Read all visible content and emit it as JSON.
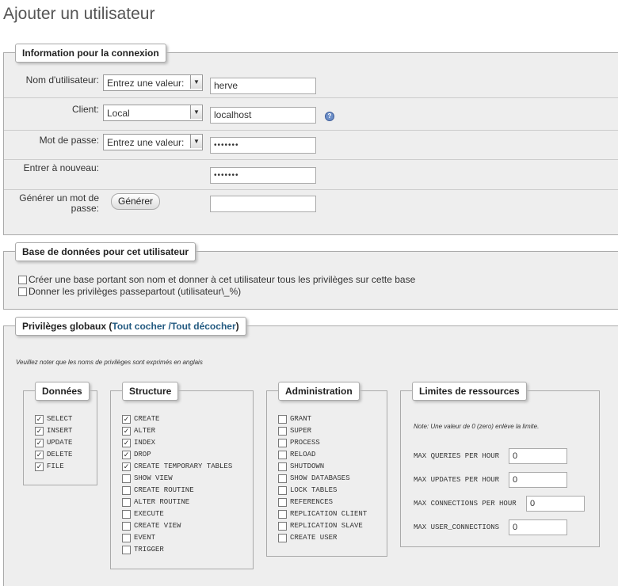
{
  "page_title": "Ajouter un utilisateur",
  "connexion": {
    "legend": "Information pour la connexion",
    "username_label": "Nom d'utilisateur:",
    "username_select": "Entrez une valeur:",
    "username_value": "herve",
    "client_label": "Client:",
    "client_select": "Local",
    "client_value": "localhost",
    "password_label": "Mot de passe:",
    "password_select": "Entrez une valeur:",
    "password_value": "•••••••",
    "retype_label": "Entrer à nouveau:",
    "retype_value": "•••••••",
    "generate_label_1": "Générer un mot de",
    "generate_label_2": "passe:",
    "generate_button": "Générer",
    "generate_value": ""
  },
  "database": {
    "legend": "Base de données pour cet utilisateur",
    "option1": "Créer une base portant son nom et donner à cet utilisateur tous les privilèges sur cette base",
    "option2": "Donner les privilèges passepartout (utilisateur\\_%)"
  },
  "privileges": {
    "legend_prefix": "Privilèges globaux (",
    "check_all": "Tout cocher",
    "sep": " /",
    "uncheck_all": "Tout décocher",
    "legend_suffix": ")",
    "note": "Veuillez noter que les noms de privilèges sont exprimés en anglais",
    "donnees": {
      "legend": "Données",
      "items": [
        {
          "label": "SELECT",
          "checked": true
        },
        {
          "label": "INSERT",
          "checked": true
        },
        {
          "label": "UPDATE",
          "checked": true
        },
        {
          "label": "DELETE",
          "checked": true
        },
        {
          "label": "FILE",
          "checked": true
        }
      ]
    },
    "structure": {
      "legend": "Structure",
      "items": [
        {
          "label": "CREATE",
          "checked": true
        },
        {
          "label": "ALTER",
          "checked": true
        },
        {
          "label": "INDEX",
          "checked": true
        },
        {
          "label": "DROP",
          "checked": true
        },
        {
          "label": "CREATE TEMPORARY TABLES",
          "checked": true
        },
        {
          "label": "SHOW VIEW",
          "checked": false
        },
        {
          "label": "CREATE ROUTINE",
          "checked": false
        },
        {
          "label": "ALTER ROUTINE",
          "checked": false
        },
        {
          "label": "EXECUTE",
          "checked": false
        },
        {
          "label": "CREATE VIEW",
          "checked": false
        },
        {
          "label": "EVENT",
          "checked": false
        },
        {
          "label": "TRIGGER",
          "checked": false
        }
      ]
    },
    "administration": {
      "legend": "Administration",
      "items": [
        {
          "label": "GRANT",
          "checked": false
        },
        {
          "label": "SUPER",
          "checked": false
        },
        {
          "label": "PROCESS",
          "checked": false
        },
        {
          "label": "RELOAD",
          "checked": false
        },
        {
          "label": "SHUTDOWN",
          "checked": false
        },
        {
          "label": "SHOW DATABASES",
          "checked": false
        },
        {
          "label": "LOCK TABLES",
          "checked": false
        },
        {
          "label": "REFERENCES",
          "checked": false
        },
        {
          "label": "REPLICATION CLIENT",
          "checked": false
        },
        {
          "label": "REPLICATION SLAVE",
          "checked": false
        },
        {
          "label": "CREATE USER",
          "checked": false
        }
      ]
    },
    "limits": {
      "legend": "Limites de ressources",
      "note": "Note: Une valeur de 0 (zero) enlève la limite.",
      "items": [
        {
          "label": "MAX QUERIES PER HOUR",
          "value": "0"
        },
        {
          "label": "MAX UPDATES PER HOUR",
          "value": "0"
        },
        {
          "label": "MAX CONNECTIONS PER HOUR",
          "value": "0"
        },
        {
          "label": "MAX USER_CONNECTIONS",
          "value": "0"
        }
      ]
    }
  }
}
